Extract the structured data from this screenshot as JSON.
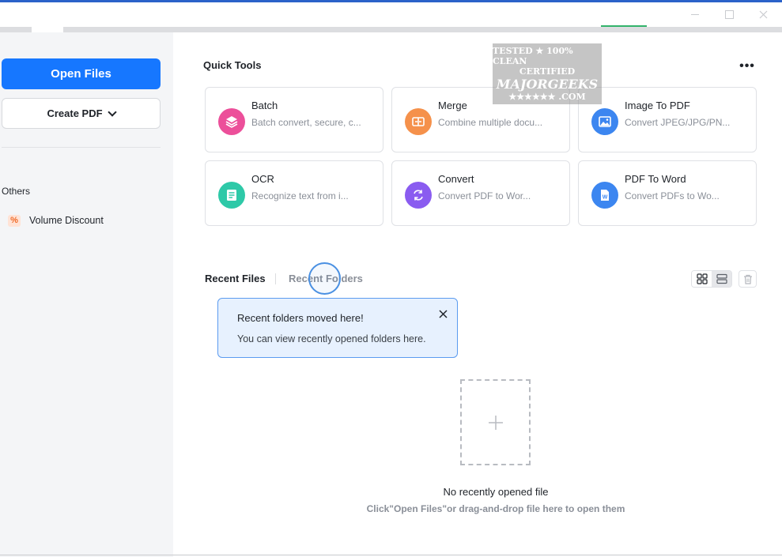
{
  "window": {
    "accent_color": "#2b62c9",
    "controls": [
      "minimize-icon",
      "maximize-icon",
      "close-icon"
    ]
  },
  "sidebar": {
    "open_files_label": "Open Files",
    "create_pdf_label": "Create PDF",
    "others_label": "Others",
    "items": [
      {
        "label": "Volume Discount",
        "icon": "percent-icon",
        "icon_glyph": "%"
      }
    ]
  },
  "quick_tools": {
    "title": "Quick Tools",
    "more_icon": "more-dots-icon",
    "cards": [
      {
        "title": "Batch",
        "description": "Batch convert, secure, c...",
        "icon": "layers-icon",
        "color": "#ec4f9a"
      },
      {
        "title": "Merge",
        "description": "Combine multiple docu...",
        "icon": "merge-icon",
        "color": "#f5914b"
      },
      {
        "title": "Image To PDF",
        "description": "Convert JPEG/JPG/PN...",
        "icon": "image-icon",
        "color": "#3c86f0"
      },
      {
        "title": "OCR",
        "description": "Recognize text from i...",
        "icon": "ocr-icon",
        "color": "#2ec9a8"
      },
      {
        "title": "Convert",
        "description": "Convert PDF to Wor...",
        "icon": "convert-icon",
        "color": "#8a5cf0"
      },
      {
        "title": "PDF To Word",
        "description": "Convert PDFs to Wo...",
        "icon": "word-icon",
        "color": "#3c86f0"
      }
    ]
  },
  "watermark": {
    "line1": "TESTED ★ 100% CLEAN",
    "line2": "CERTIFIED",
    "line3": "MAJORGEEKS",
    "line4": "★★★★★★ .COM"
  },
  "recent": {
    "tab_files": "Recent Files",
    "tab_folders": "Recent Folders",
    "active_tab": "Recent Files",
    "view_grid_icon": "grid-view-icon",
    "view_list_icon": "list-view-icon",
    "delete_icon": "trash-icon"
  },
  "tooltip": {
    "title": "Recent folders moved here!",
    "body": "You can view recently opened folders here."
  },
  "empty_state": {
    "title": "No recently opened file",
    "hint": "Click\"Open Files\"or drag-and-drop file here to open them"
  }
}
